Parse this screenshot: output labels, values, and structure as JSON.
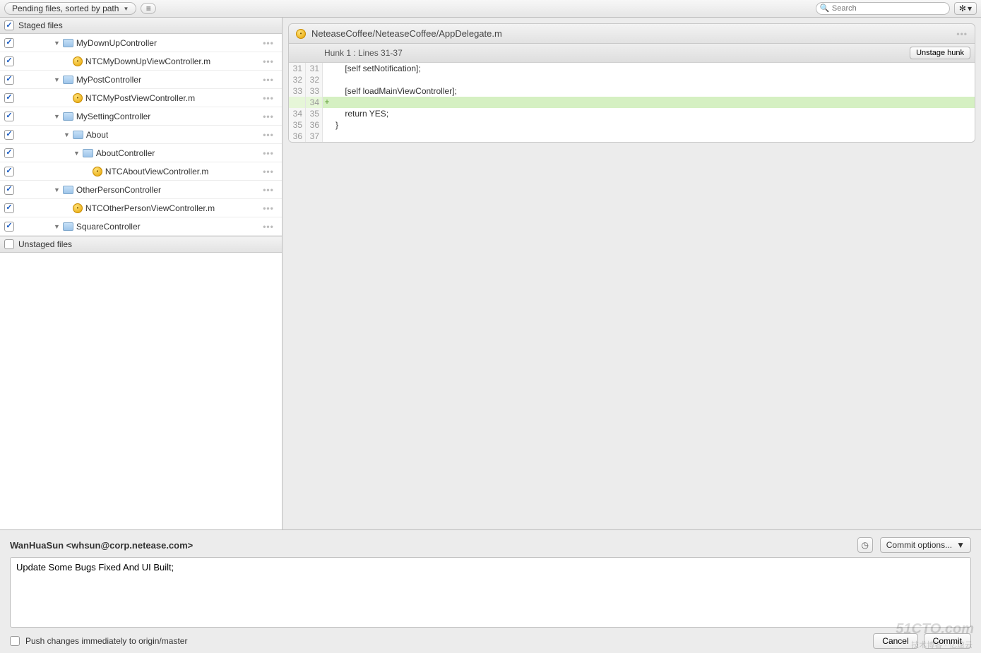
{
  "toolbar": {
    "sort_label": "Pending files, sorted by path",
    "search_placeholder": "Search"
  },
  "sidebar": {
    "staged_header": "Staged files",
    "unstaged_header": "Unstaged files",
    "items": [
      {
        "type": "folder",
        "label": "MyDownUpController",
        "indent": 1,
        "dots": true
      },
      {
        "type": "file",
        "label": "NTCMyDownUpViewController.m",
        "indent": 2,
        "dots": true
      },
      {
        "type": "folder",
        "label": "MyPostController",
        "indent": 1,
        "dots": true
      },
      {
        "type": "file",
        "label": "NTCMyPostViewController.m",
        "indent": 2,
        "dots": true
      },
      {
        "type": "folder",
        "label": "MySettingController",
        "indent": 1,
        "dots": true
      },
      {
        "type": "folder",
        "label": "About",
        "indent": 2,
        "dots": true
      },
      {
        "type": "folder",
        "label": "AboutController",
        "indent": 3,
        "dots": true
      },
      {
        "type": "file",
        "label": "NTCAboutViewController.m",
        "indent": 4,
        "dots": true
      },
      {
        "type": "folder",
        "label": "OtherPersonController",
        "indent": 1,
        "dots": true
      },
      {
        "type": "file",
        "label": "NTCOtherPersonViewController.m",
        "indent": 2,
        "dots": true
      },
      {
        "type": "folder",
        "label": "SquareController",
        "indent": 1,
        "dots": true
      }
    ]
  },
  "diff": {
    "file_path": "NeteaseCoffee/NeteaseCoffee/AppDelegate.m",
    "hunk_title": "Hunk 1 : Lines 31-37",
    "unstage_label": "Unstage hunk",
    "lines": [
      {
        "old": "31",
        "new": "31",
        "mark": "",
        "text": "    [self setNotification];"
      },
      {
        "old": "32",
        "new": "32",
        "mark": "",
        "text": ""
      },
      {
        "old": "33",
        "new": "33",
        "mark": "",
        "text": "    [self loadMainViewController];"
      },
      {
        "old": "",
        "new": "34",
        "mark": "+",
        "text": "",
        "added": true
      },
      {
        "old": "34",
        "new": "35",
        "mark": "",
        "text": "    return YES;"
      },
      {
        "old": "35",
        "new": "36",
        "mark": "",
        "text": "}"
      },
      {
        "old": "36",
        "new": "37",
        "mark": "",
        "text": ""
      }
    ]
  },
  "commit": {
    "author": "WanHuaSun <whsun@corp.netease.com>",
    "options_label": "Commit options...",
    "message": "Update Some Bugs Fixed And UI Built;",
    "push_label": "Push changes immediately to origin/master",
    "cancel_label": "Cancel",
    "commit_label": "Commit"
  },
  "watermark": {
    "a": "51CTO.com",
    "b": "技术博客 · 亿速云"
  }
}
